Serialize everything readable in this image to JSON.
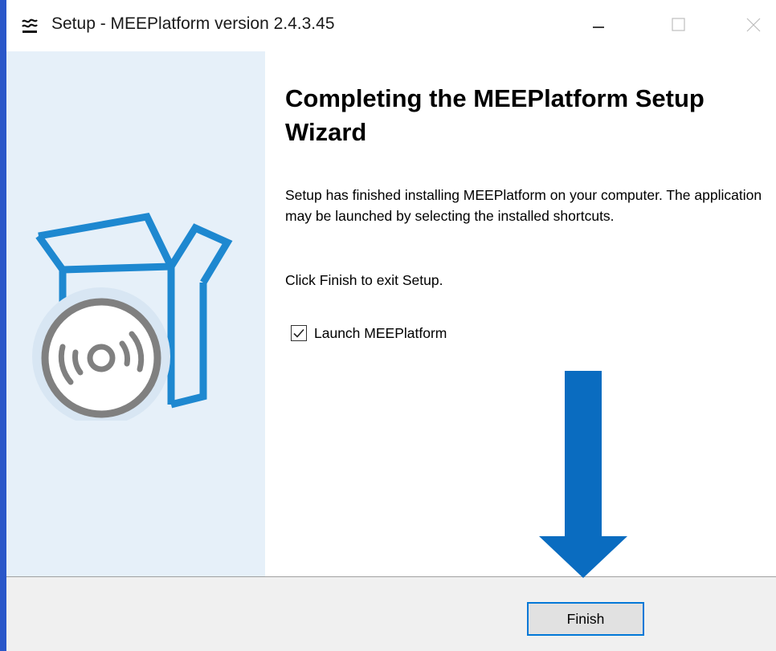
{
  "window": {
    "title": "Setup - MEEPlatform version 2.4.3.45",
    "icons": {
      "app": "app-logo-icon",
      "minimize": "minimize-icon",
      "maximize": "maximize-icon",
      "close": "close-icon"
    }
  },
  "wizard": {
    "heading": "Completing the MEEPlatform Setup Wizard",
    "body": "Setup has finished installing MEEPlatform on your computer. The application may be launched by selecting the installed shortcuts.",
    "instruction": "Click Finish to exit Setup.",
    "launch_checkbox": {
      "label": "Launch MEEPlatform",
      "checked": true
    },
    "illustration": "software-box-cd-icon"
  },
  "footer": {
    "finish_label": "Finish"
  },
  "annotation": {
    "arrow": "down-arrow-icon",
    "arrow_color": "#0a6cc0"
  },
  "colors": {
    "sidebar_bg": "#e6f0f9",
    "box_blue": "#1e88d0",
    "disc_gray": "#808080",
    "outer_frame": "#2a57c9",
    "focus_border": "#0078d7"
  }
}
